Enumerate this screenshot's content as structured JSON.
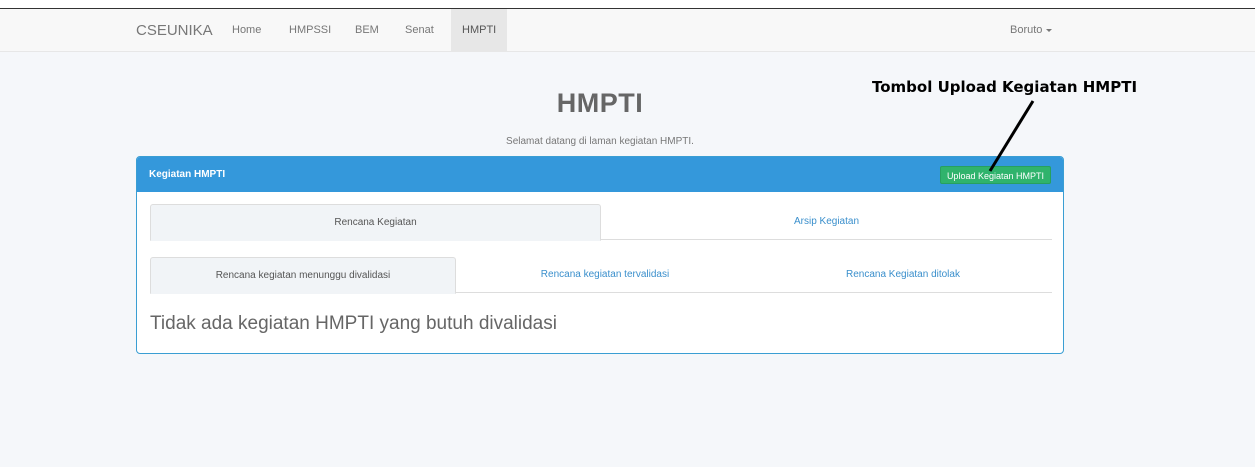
{
  "navbar": {
    "brand": "CSEUNIKA",
    "items": [
      {
        "label": "Home"
      },
      {
        "label": "HMPSSI"
      },
      {
        "label": "BEM"
      },
      {
        "label": "Senat"
      },
      {
        "label": "HMPTI",
        "active": true
      }
    ],
    "user": "Boruto"
  },
  "header": {
    "title": "HMPTI",
    "subtitle": "Selamat datang di laman kegiatan HMPTI."
  },
  "annotation": {
    "text": "Tombol Upload Kegiatan HMPTI"
  },
  "panel": {
    "title": "Kegiatan HMPTI",
    "upload_button": "Upload Kegiatan HMPTI",
    "main_tabs": [
      {
        "label": "Rencana Kegiatan",
        "active": true
      },
      {
        "label": "Arsip Kegiatan",
        "active": false
      }
    ],
    "sub_tabs": [
      {
        "label": "Rencana kegiatan menunggu divalidasi",
        "active": true
      },
      {
        "label": "Rencana kegiatan tervalidasi",
        "active": false
      },
      {
        "label": "Rencana Kegiatan ditolak",
        "active": false
      }
    ],
    "empty_message": "Tidak ada kegiatan HMPTI yang butuh divalidasi"
  },
  "colors": {
    "panel_heading": "#3498db",
    "upload_button": "#2fb36c",
    "link": "#3a8fcc"
  }
}
